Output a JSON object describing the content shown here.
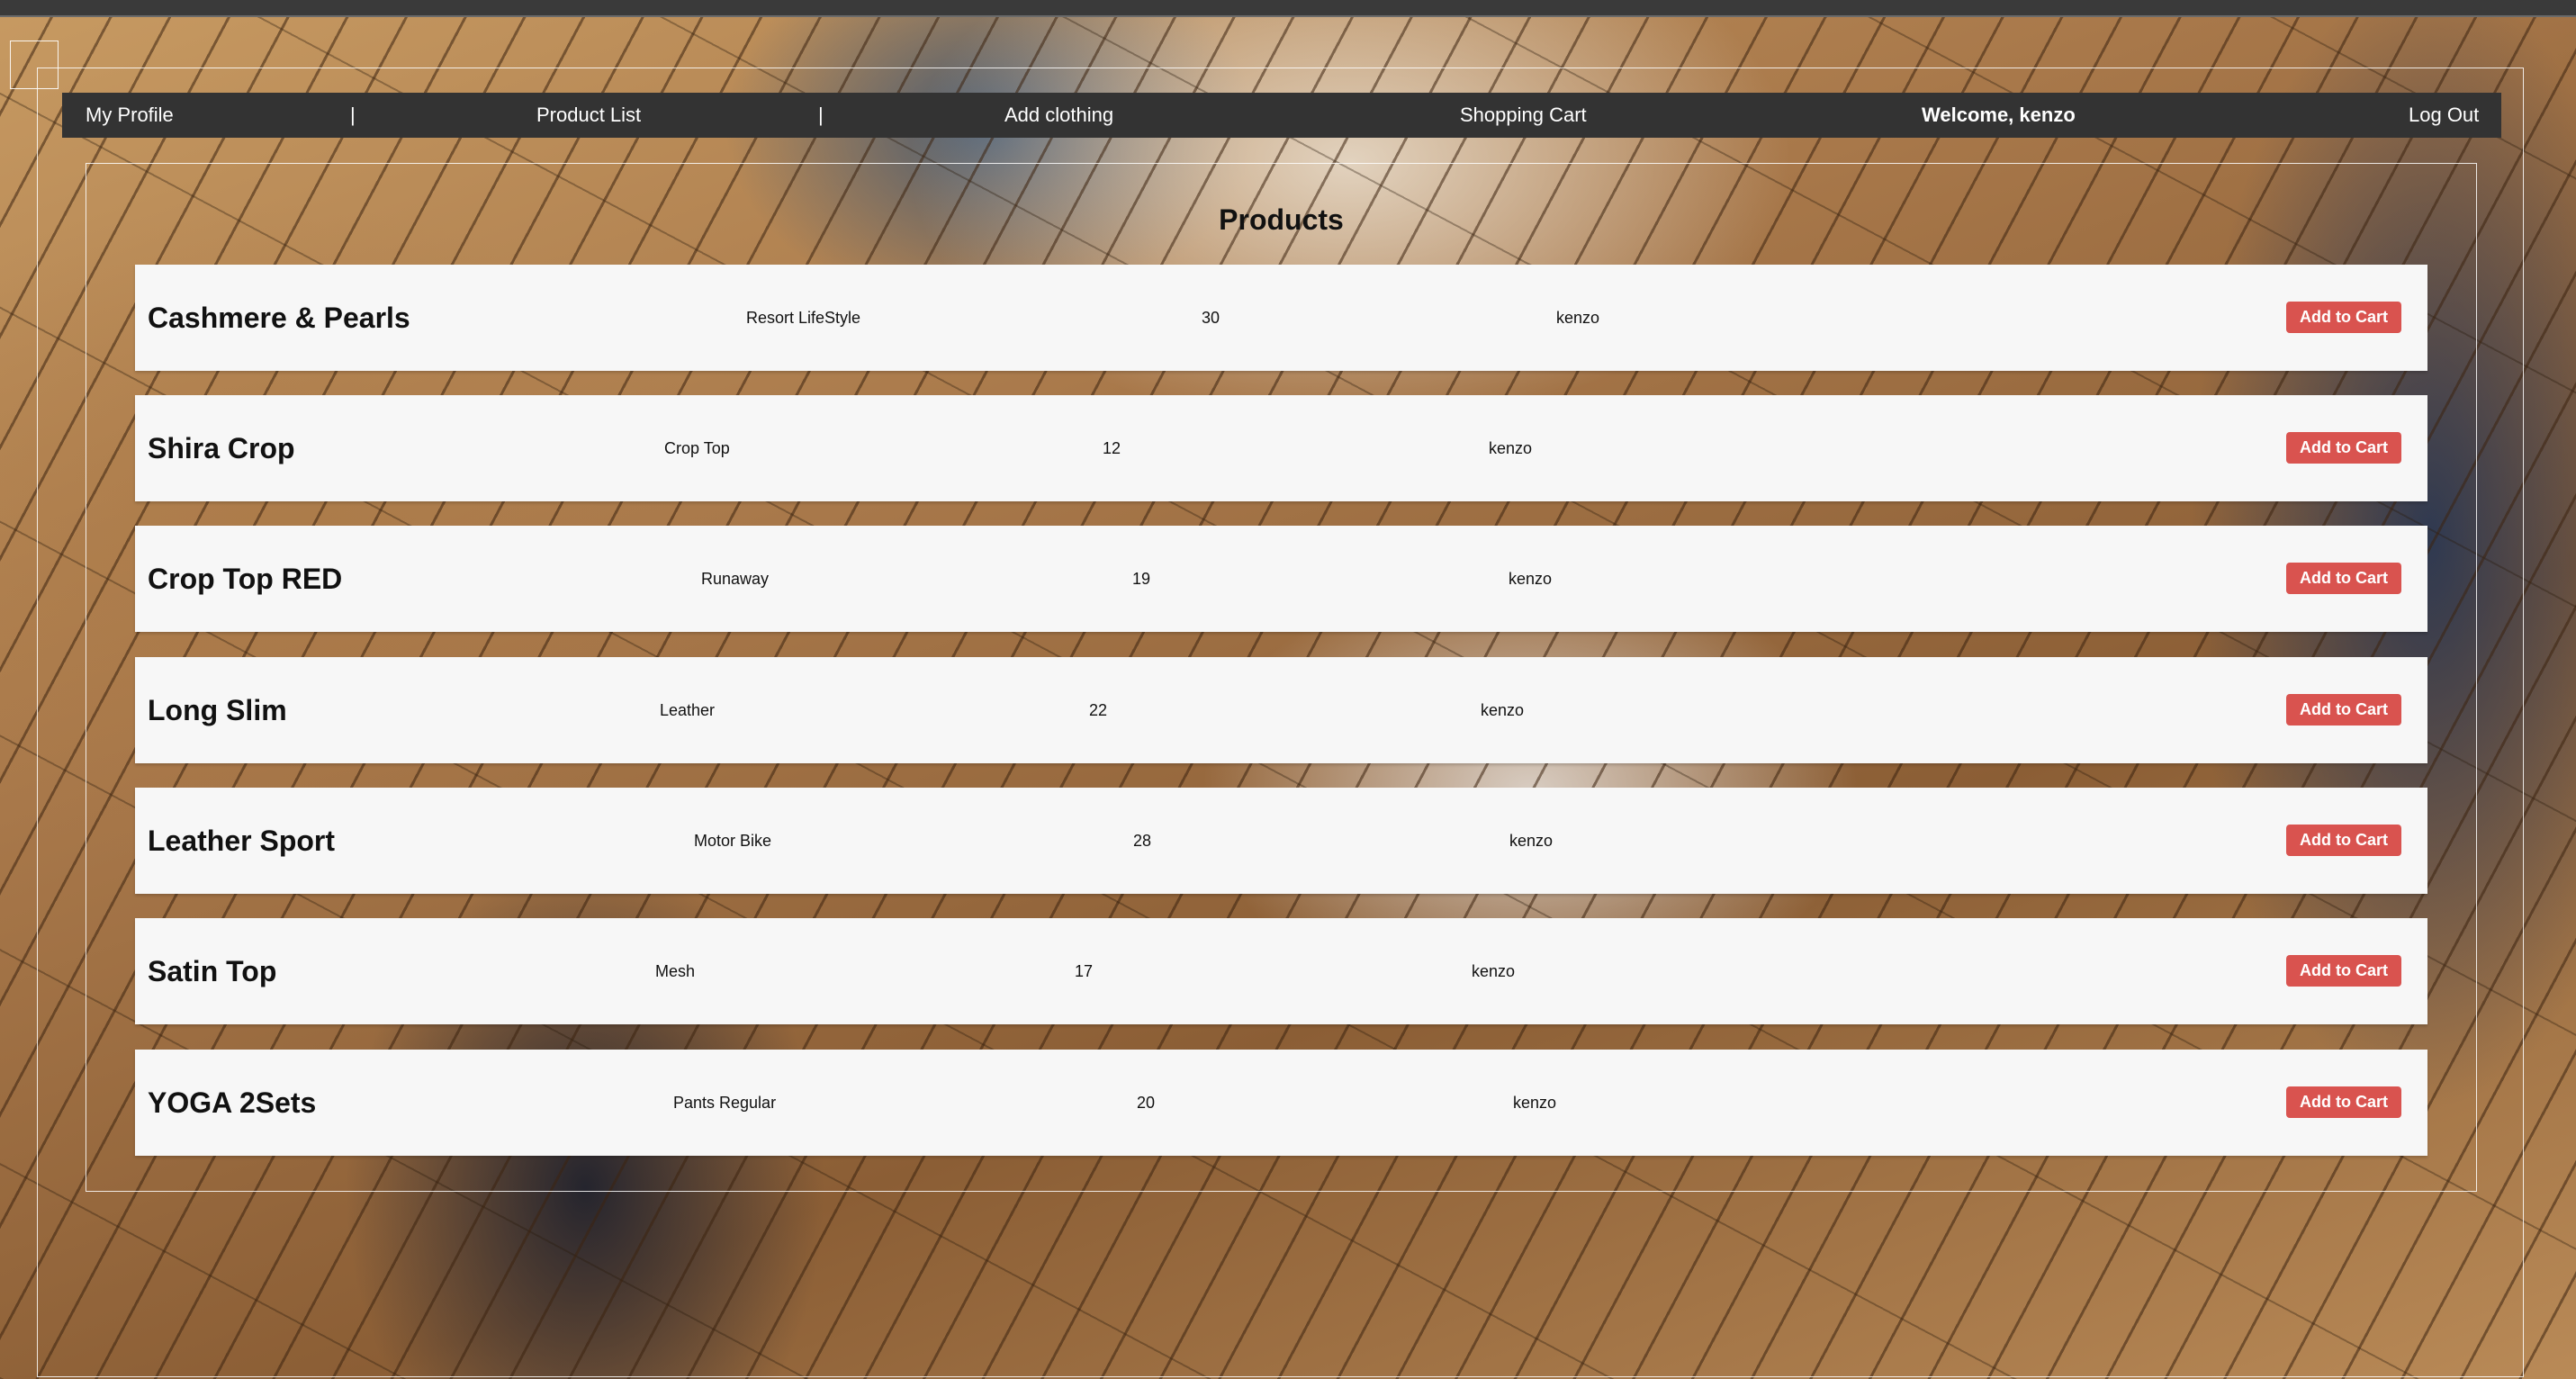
{
  "nav": {
    "profile": "My Profile",
    "separator": "|",
    "product_list": "Product List",
    "add_clothing": "Add clothing",
    "shopping_cart": "Shopping Cart",
    "welcome": "Welcome, kenzo",
    "logout": "Log Out"
  },
  "page": {
    "title": "Products"
  },
  "products": [
    {
      "name": "Cashmere & Pearls",
      "category": "Resort LifeStyle",
      "price": "30",
      "owner": "kenzo",
      "button": "Add to Cart"
    },
    {
      "name": "Shira Crop",
      "category": "Crop Top",
      "price": "12",
      "owner": "kenzo",
      "button": "Add to Cart"
    },
    {
      "name": "Crop Top RED",
      "category": "Runaway",
      "price": "19",
      "owner": "kenzo",
      "button": "Add to Cart"
    },
    {
      "name": "Long Slim",
      "category": "Leather",
      "price": "22",
      "owner": "kenzo",
      "button": "Add to Cart"
    },
    {
      "name": "Leather Sport",
      "category": "Motor Bike",
      "price": "28",
      "owner": "kenzo",
      "button": "Add to Cart"
    },
    {
      "name": "Satin Top",
      "category": "Mesh",
      "price": "17",
      "owner": "kenzo",
      "button": "Add to Cart"
    },
    {
      "name": "YOGA 2Sets",
      "category": "Pants Regular",
      "price": "20",
      "owner": "kenzo",
      "button": "Add to Cart"
    }
  ],
  "colors": {
    "navbar_bg": "#333333",
    "button_bg": "#d9534f",
    "row_bg": "#f7f7f7"
  }
}
